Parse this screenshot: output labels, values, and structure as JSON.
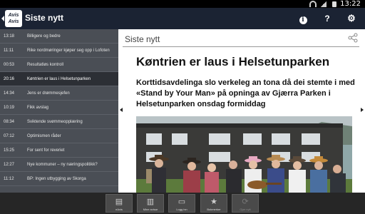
{
  "status": {
    "time": "13:22"
  },
  "app": {
    "logo_text": "Avis Avis",
    "title": "Siste nytt"
  },
  "sidebar": {
    "items": [
      {
        "time": "13:18",
        "headline": "Billigere og bedre"
      },
      {
        "time": "11:11",
        "headline": "Rike nordmøringer kjøper seg opp i Lofoten"
      },
      {
        "time": "00:53",
        "headline": "Resultatløs kontroll"
      },
      {
        "time": "20:16",
        "headline": "Køntrien er laus i Helsetunparken"
      },
      {
        "time": "14:34",
        "headline": "Jens er drømmesjefen"
      },
      {
        "time": "10:19",
        "headline": "Fikk avslag"
      },
      {
        "time": "08:34",
        "headline": "Sviktende svømmeopplæring"
      },
      {
        "time": "07:12",
        "headline": "Optimismen råder"
      },
      {
        "time": "15:25",
        "headline": "For sent for reveriet"
      },
      {
        "time": "12:27",
        "headline": "Nye kommuner – ny næringspolitikk?"
      },
      {
        "time": "11:12",
        "headline": "BP: Ingen utbygging av Skorga"
      }
    ]
  },
  "article": {
    "section": "Siste nytt",
    "headline": "Køntrien er laus i Helsetunparken",
    "lead": "Korttidsavdelinga slo verkeleg an tona då dei stemte i med «Stand by Your Man» på opninga av Gjærra Parken i Helsetunparken onsdag formiddag"
  },
  "toolbar": {
    "buttons": [
      {
        "label": "eAvis",
        "icon": "newspaper-icon"
      },
      {
        "label": "Mine avisar",
        "icon": "newspapers-icon"
      },
      {
        "label": "Logg inn",
        "icon": "login-icon"
      },
      {
        "label": "Bokmerker",
        "icon": "star-icon"
      },
      {
        "label": "Gjør nytt",
        "icon": "refresh-icon"
      }
    ]
  },
  "colors": {
    "appbar": "#1b2333",
    "sidebar": "#4a4e55",
    "sidebar_active": "#2c2f35",
    "toolbar": "#262626"
  }
}
